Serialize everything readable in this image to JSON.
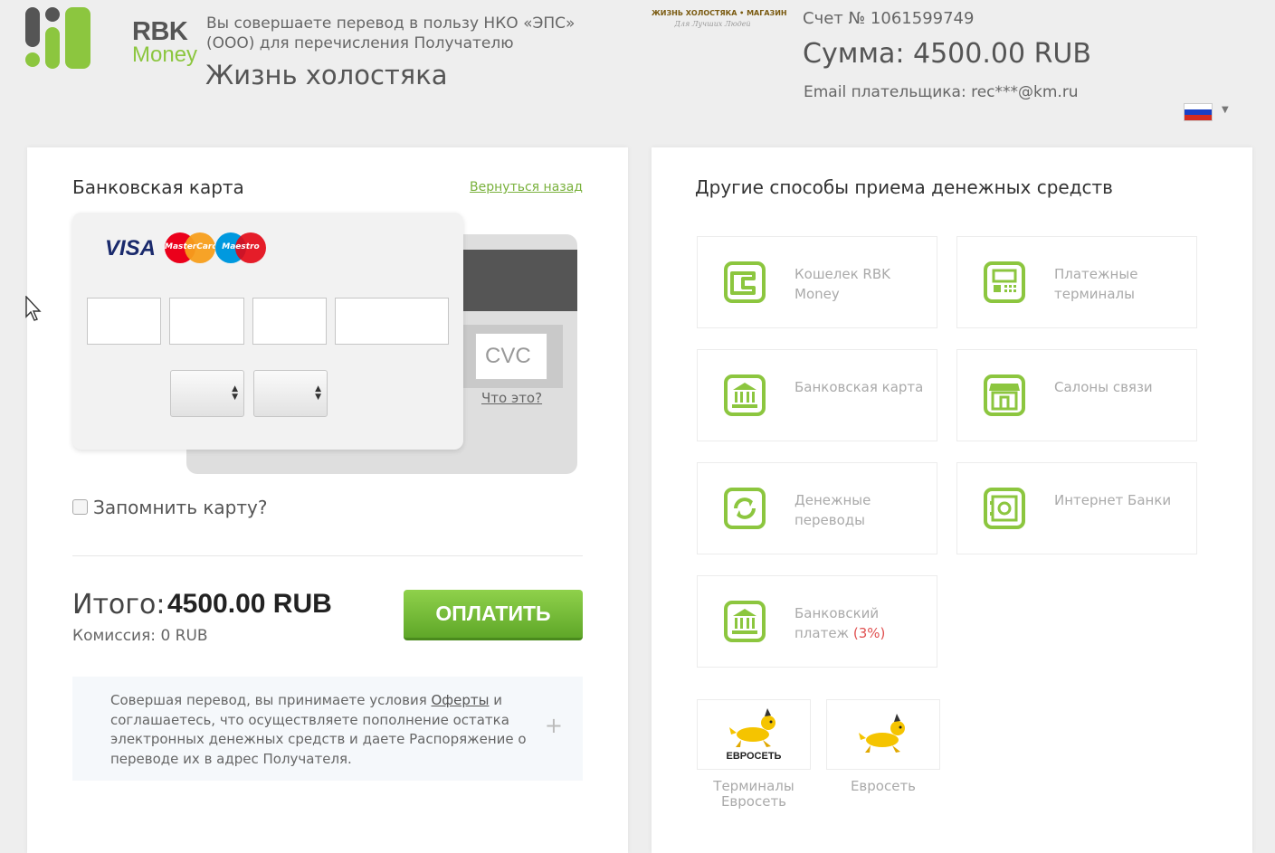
{
  "header": {
    "logo": {
      "line1": "RBK",
      "line2": "Money"
    },
    "description": "Вы совершаете перевод в пользу НКО «ЭПС» (ООО) для перечисления Получателю",
    "merchant_name": "Жизнь холостяка",
    "merchant_logo": {
      "line1": "ЖИЗНЬ ХОЛОСТЯКА • МАГАЗИН",
      "line2": "Для Лучших Людей"
    },
    "account": "Счет № 1061599749",
    "sum": "Сумма: 4500.00 RUB",
    "email": "Email плательщика: rec***@km.ru",
    "language": {
      "flag": "russia-flag",
      "caret": "▼"
    }
  },
  "card_form": {
    "title": "Банковская карта",
    "back_link": "Вернуться назад",
    "brands": {
      "visa": "VISA",
      "mastercard": "MasterCard",
      "maestro": "Maestro"
    },
    "card_number_fields": [
      "",
      "",
      "",
      ""
    ],
    "expiry_month": "",
    "expiry_year": "",
    "cvc_placeholder": "CVC",
    "cvc_help": "Что это?",
    "remember_label": "Запомнить карту?",
    "total_label": "Итого:",
    "total_value": "4500.00 RUB",
    "commission": "Комиссия: 0 RUB",
    "pay_button": "ОПЛАТИТЬ",
    "terms": {
      "before": "Совершая перевод, вы принимаете условия ",
      "link": "Оферты",
      "after": " и соглашаетесь, что осуществляете пополнение остатка электронных денежных средств и даете Распоряжение о переводе их в адрес Получателя."
    },
    "terms_expand": "+"
  },
  "other_methods": {
    "title": "Другие способы приема денежных средств",
    "methods": [
      {
        "label": "Кошелек RBK Money",
        "icon": "wallet-icon"
      },
      {
        "label": "Платежные терминалы",
        "icon": "terminal-icon"
      },
      {
        "label": "Банковская карта",
        "icon": "bank-icon"
      },
      {
        "label": "Салоны связи",
        "icon": "store-icon"
      },
      {
        "label": "Денежные переводы",
        "icon": "transfer-icon"
      },
      {
        "label": "Интернет Банки",
        "icon": "safe-icon"
      },
      {
        "label": "Банковский платеж",
        "label_suffix": "(3%)",
        "icon": "bank-icon"
      }
    ],
    "tiles": [
      {
        "label": "Терминалы Евросеть",
        "logo_text": "ЕВРОСЕТЬ",
        "icon": "euroset-dog-icon"
      },
      {
        "label": "Евросеть",
        "icon": "euroset-dog-icon"
      }
    ]
  },
  "colors": {
    "accent": "#8cc63f",
    "button": "#6bb32e",
    "link": "#79b13c",
    "danger": "#e05050"
  }
}
